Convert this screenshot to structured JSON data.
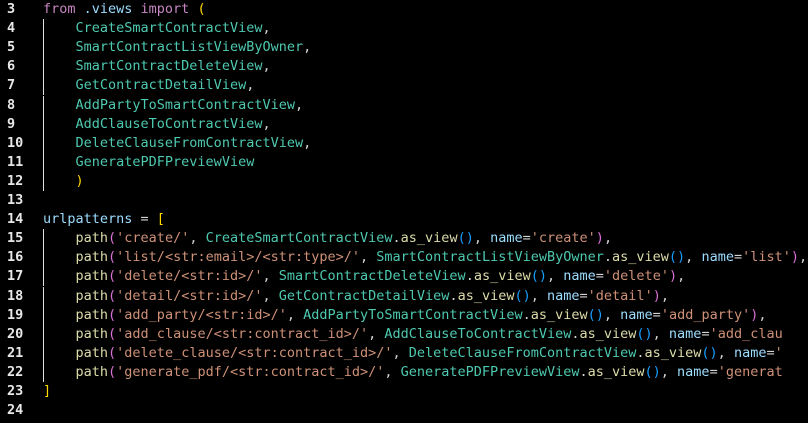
{
  "editor": {
    "theme_colors": {
      "keyword": "#c586c0",
      "class": "#4ec9b0",
      "function": "#dcdcaa",
      "string": "#ce9178",
      "variable": "#9cdcfe",
      "background": "#000000"
    },
    "lines": [
      {
        "n": "3",
        "guide": false,
        "tokens": [
          [
            "from",
            "kw"
          ],
          [
            " .views ",
            "mod"
          ],
          [
            "import",
            "kw"
          ],
          [
            " ",
            "pl"
          ],
          [
            "(",
            "b1"
          ]
        ]
      },
      {
        "n": "4",
        "guide": true,
        "tokens": [
          [
            "    ",
            "pl"
          ],
          [
            "CreateSmartContractView",
            "cls"
          ],
          [
            ",",
            "pl"
          ]
        ]
      },
      {
        "n": "5",
        "guide": true,
        "tokens": [
          [
            "    ",
            "pl"
          ],
          [
            "SmartContractListViewByOwner",
            "cls"
          ],
          [
            ",",
            "pl"
          ]
        ]
      },
      {
        "n": "6",
        "guide": true,
        "tokens": [
          [
            "    ",
            "pl"
          ],
          [
            "SmartContractDeleteView",
            "cls"
          ],
          [
            ",",
            "pl"
          ]
        ]
      },
      {
        "n": "7",
        "guide": true,
        "tokens": [
          [
            "    ",
            "pl"
          ],
          [
            "GetContractDetailView",
            "cls"
          ],
          [
            ",",
            "pl"
          ]
        ]
      },
      {
        "n": "8",
        "guide": true,
        "tokens": [
          [
            "    ",
            "pl"
          ],
          [
            "AddPartyToSmartContractView",
            "cls"
          ],
          [
            ",",
            "pl"
          ]
        ]
      },
      {
        "n": "9",
        "guide": true,
        "tokens": [
          [
            "    ",
            "pl"
          ],
          [
            "AddClauseToContractView",
            "cls"
          ],
          [
            ",",
            "pl"
          ]
        ]
      },
      {
        "n": "10",
        "guide": true,
        "tokens": [
          [
            "    ",
            "pl"
          ],
          [
            "DeleteClauseFromContractView",
            "cls"
          ],
          [
            ",",
            "pl"
          ]
        ]
      },
      {
        "n": "11",
        "guide": true,
        "tokens": [
          [
            "    ",
            "pl"
          ],
          [
            "GeneratePDFPreviewView",
            "cls"
          ]
        ]
      },
      {
        "n": "12",
        "guide": true,
        "tokens": [
          [
            "    ",
            "pl"
          ],
          [
            ")",
            "b1"
          ]
        ]
      },
      {
        "n": "13",
        "guide": false,
        "tokens": []
      },
      {
        "n": "14",
        "guide": false,
        "tokens": [
          [
            "urlpatterns",
            "var"
          ],
          [
            " = ",
            "op"
          ],
          [
            "[",
            "b1"
          ]
        ]
      },
      {
        "n": "15",
        "guide": true,
        "tokens": [
          [
            "    ",
            "pl"
          ],
          [
            "path",
            "fn"
          ],
          [
            "(",
            "b2"
          ],
          [
            "'create/'",
            "str"
          ],
          [
            ", ",
            "pl"
          ],
          [
            "CreateSmartContractView",
            "cls"
          ],
          [
            ".",
            "pl"
          ],
          [
            "as_view",
            "fn"
          ],
          [
            "()",
            "b3"
          ],
          [
            ", ",
            "pl"
          ],
          [
            "name",
            "var"
          ],
          [
            "=",
            "op"
          ],
          [
            "'create'",
            "str"
          ],
          [
            ")",
            "b2"
          ],
          [
            ",",
            "pl"
          ]
        ]
      },
      {
        "n": "16",
        "guide": true,
        "tokens": [
          [
            "    ",
            "pl"
          ],
          [
            "path",
            "fn"
          ],
          [
            "(",
            "b2"
          ],
          [
            "'list/<str:email>/<str:type>/'",
            "str"
          ],
          [
            ", ",
            "pl"
          ],
          [
            "SmartContractListViewByOwner",
            "cls"
          ],
          [
            ".",
            "pl"
          ],
          [
            "as_view",
            "fn"
          ],
          [
            "()",
            "b3"
          ],
          [
            ", ",
            "pl"
          ],
          [
            "name",
            "var"
          ],
          [
            "=",
            "op"
          ],
          [
            "'list'",
            "str"
          ],
          [
            ")",
            "b2"
          ],
          [
            ",",
            "pl"
          ]
        ]
      },
      {
        "n": "17",
        "guide": true,
        "tokens": [
          [
            "    ",
            "pl"
          ],
          [
            "path",
            "fn"
          ],
          [
            "(",
            "b2"
          ],
          [
            "'delete/<str:id>/'",
            "str"
          ],
          [
            ", ",
            "pl"
          ],
          [
            "SmartContractDeleteView",
            "cls"
          ],
          [
            ".",
            "pl"
          ],
          [
            "as_view",
            "fn"
          ],
          [
            "()",
            "b3"
          ],
          [
            ", ",
            "pl"
          ],
          [
            "name",
            "var"
          ],
          [
            "=",
            "op"
          ],
          [
            "'delete'",
            "str"
          ],
          [
            ")",
            "b2"
          ],
          [
            ",",
            "pl"
          ]
        ]
      },
      {
        "n": "18",
        "guide": true,
        "tokens": [
          [
            "    ",
            "pl"
          ],
          [
            "path",
            "fn"
          ],
          [
            "(",
            "b2"
          ],
          [
            "'detail/<str:id>/'",
            "str"
          ],
          [
            ", ",
            "pl"
          ],
          [
            "GetContractDetailView",
            "cls"
          ],
          [
            ".",
            "pl"
          ],
          [
            "as_view",
            "fn"
          ],
          [
            "()",
            "b3"
          ],
          [
            ", ",
            "pl"
          ],
          [
            "name",
            "var"
          ],
          [
            "=",
            "op"
          ],
          [
            "'detail'",
            "str"
          ],
          [
            ")",
            "b2"
          ],
          [
            ",",
            "pl"
          ]
        ]
      },
      {
        "n": "19",
        "guide": true,
        "tokens": [
          [
            "    ",
            "pl"
          ],
          [
            "path",
            "fn"
          ],
          [
            "(",
            "b2"
          ],
          [
            "'add_party/<str:id>/'",
            "str"
          ],
          [
            ", ",
            "pl"
          ],
          [
            "AddPartyToSmartContractView",
            "cls"
          ],
          [
            ".",
            "pl"
          ],
          [
            "as_view",
            "fn"
          ],
          [
            "()",
            "b3"
          ],
          [
            ", ",
            "pl"
          ],
          [
            "name",
            "var"
          ],
          [
            "=",
            "op"
          ],
          [
            "'add_party'",
            "str"
          ],
          [
            ")",
            "b2"
          ],
          [
            ",",
            "pl"
          ]
        ]
      },
      {
        "n": "20",
        "guide": true,
        "tokens": [
          [
            "    ",
            "pl"
          ],
          [
            "path",
            "fn"
          ],
          [
            "(",
            "b2"
          ],
          [
            "'add_clause/<str:contract_id>/'",
            "str"
          ],
          [
            ", ",
            "pl"
          ],
          [
            "AddClauseToContractView",
            "cls"
          ],
          [
            ".",
            "pl"
          ],
          [
            "as_view",
            "fn"
          ],
          [
            "()",
            "b3"
          ],
          [
            ", ",
            "pl"
          ],
          [
            "name",
            "var"
          ],
          [
            "=",
            "op"
          ],
          [
            "'add_clau",
            "str"
          ]
        ]
      },
      {
        "n": "21",
        "guide": true,
        "tokens": [
          [
            "    ",
            "pl"
          ],
          [
            "path",
            "fn"
          ],
          [
            "(",
            "b2"
          ],
          [
            "'delete_clause/<str:contract_id>/'",
            "str"
          ],
          [
            ", ",
            "pl"
          ],
          [
            "DeleteClauseFromContractView",
            "cls"
          ],
          [
            ".",
            "pl"
          ],
          [
            "as_view",
            "fn"
          ],
          [
            "()",
            "b3"
          ],
          [
            ", ",
            "pl"
          ],
          [
            "name",
            "var"
          ],
          [
            "=",
            "op"
          ],
          [
            "'",
            "str"
          ]
        ]
      },
      {
        "n": "22",
        "guide": true,
        "tokens": [
          [
            "    ",
            "pl"
          ],
          [
            "path",
            "fn"
          ],
          [
            "(",
            "b2"
          ],
          [
            "'generate_pdf/<str:contract_id>/'",
            "str"
          ],
          [
            ", ",
            "pl"
          ],
          [
            "GeneratePDFPreviewView",
            "cls"
          ],
          [
            ".",
            "pl"
          ],
          [
            "as_view",
            "fn"
          ],
          [
            "()",
            "b3"
          ],
          [
            ", ",
            "pl"
          ],
          [
            "name",
            "var"
          ],
          [
            "=",
            "op"
          ],
          [
            "'generat",
            "str"
          ]
        ]
      },
      {
        "n": "23",
        "guide": false,
        "tokens": [
          [
            "]",
            "b1"
          ]
        ]
      },
      {
        "n": "24",
        "guide": false,
        "tokens": []
      }
    ]
  }
}
